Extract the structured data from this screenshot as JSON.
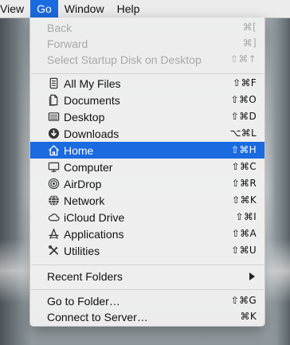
{
  "menubar": {
    "items": [
      {
        "label": "View"
      },
      {
        "label": "Go"
      },
      {
        "label": "Window"
      },
      {
        "label": "Help"
      }
    ]
  },
  "menu": {
    "history": [
      {
        "label": "Back",
        "shortcut": "⌘["
      },
      {
        "label": "Forward",
        "shortcut": "⌘]"
      },
      {
        "label": "Select Startup Disk on Desktop",
        "shortcut": "⇧⌘↑"
      }
    ],
    "places": [
      {
        "label": "All My Files",
        "shortcut": "⇧⌘F",
        "icon": "all-my-files-icon"
      },
      {
        "label": "Documents",
        "shortcut": "⇧⌘O",
        "icon": "documents-icon"
      },
      {
        "label": "Desktop",
        "shortcut": "⇧⌘D",
        "icon": "desktop-icon"
      },
      {
        "label": "Downloads",
        "shortcut": "⌥⌘L",
        "icon": "downloads-icon"
      },
      {
        "label": "Home",
        "shortcut": "⇧⌘H",
        "icon": "home-icon"
      },
      {
        "label": "Computer",
        "shortcut": "⇧⌘C",
        "icon": "computer-icon"
      },
      {
        "label": "AirDrop",
        "shortcut": "⇧⌘R",
        "icon": "airdrop-icon"
      },
      {
        "label": "Network",
        "shortcut": "⇧⌘K",
        "icon": "network-icon"
      },
      {
        "label": "iCloud Drive",
        "shortcut": "⇧⌘I",
        "icon": "icloud-icon"
      },
      {
        "label": "Applications",
        "shortcut": "⇧⌘A",
        "icon": "applications-icon"
      },
      {
        "label": "Utilities",
        "shortcut": "⇧⌘U",
        "icon": "utilities-icon"
      }
    ],
    "recent": {
      "label": "Recent Folders"
    },
    "folder_actions": [
      {
        "label": "Go to Folder…",
        "shortcut": "⇧⌘G"
      },
      {
        "label": "Connect to Server…",
        "shortcut": "⌘K"
      }
    ]
  },
  "colors": {
    "selection": "#1a6ae0",
    "disabled_text": "#a8a8a8"
  }
}
